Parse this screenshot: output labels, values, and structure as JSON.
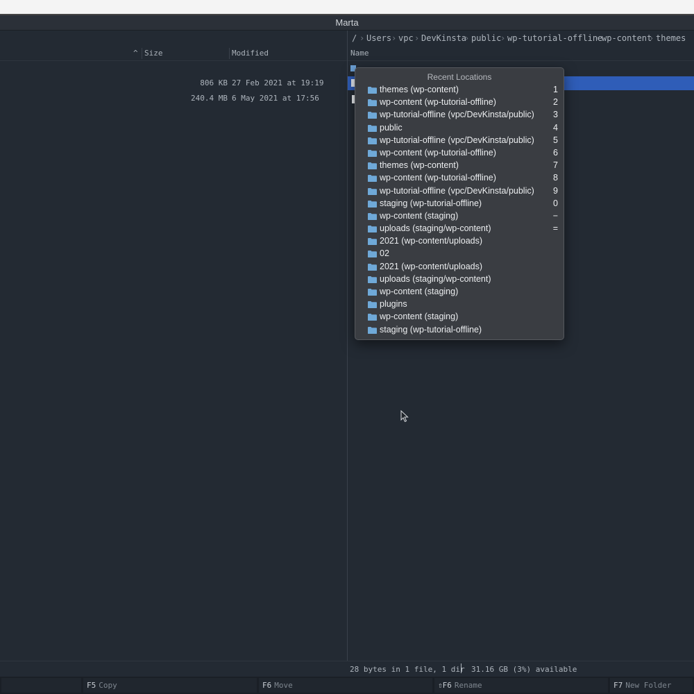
{
  "window": {
    "title": "Marta"
  },
  "left_pane": {
    "columns": {
      "size": "Size",
      "modified": "Modified",
      "sort_indicator": "^"
    },
    "rows": [
      {
        "size": "806 KB",
        "modified": "27 Feb 2021 at 19:19"
      },
      {
        "size": "240.4 MB",
        "modified": "6 May 2021 at 17:56"
      }
    ]
  },
  "right_pane": {
    "breadcrumb": [
      "/",
      "Users",
      "vpc",
      "DevKinsta",
      "public",
      "wp-tutorial-offline",
      "wp-content",
      "themes"
    ],
    "breadcrumb_separator": "›",
    "columns": {
      "name": "Name"
    },
    "status": {
      "summary": "28 bytes in 1 file, 1 dir",
      "available": "31.16 GB (3%) available"
    }
  },
  "recent_locations": {
    "title": "Recent Locations",
    "items": [
      {
        "label": "themes (wp-content)",
        "key": "1"
      },
      {
        "label": "wp-content (wp-tutorial-offline)",
        "key": "2"
      },
      {
        "label": "wp-tutorial-offline (vpc/DevKinsta/public)",
        "key": "3"
      },
      {
        "label": "public",
        "key": "4"
      },
      {
        "label": "wp-tutorial-offline (vpc/DevKinsta/public)",
        "key": "5"
      },
      {
        "label": "wp-content (wp-tutorial-offline)",
        "key": "6"
      },
      {
        "label": "themes (wp-content)",
        "key": "7"
      },
      {
        "label": "wp-content (wp-tutorial-offline)",
        "key": "8"
      },
      {
        "label": "wp-tutorial-offline (vpc/DevKinsta/public)",
        "key": "9"
      },
      {
        "label": "staging (wp-tutorial-offline)",
        "key": "0"
      },
      {
        "label": "wp-content (staging)",
        "key": "−"
      },
      {
        "label": "uploads (staging/wp-content)",
        "key": "="
      },
      {
        "label": "2021 (wp-content/uploads)",
        "key": ""
      },
      {
        "label": "02",
        "key": ""
      },
      {
        "label": "2021 (wp-content/uploads)",
        "key": ""
      },
      {
        "label": "uploads (staging/wp-content)",
        "key": ""
      },
      {
        "label": "wp-content (staging)",
        "key": ""
      },
      {
        "label": "plugins",
        "key": ""
      },
      {
        "label": "wp-content (staging)",
        "key": ""
      },
      {
        "label": "staging (wp-tutorial-offline)",
        "key": ""
      }
    ],
    "icon": "folder-icon",
    "folder_color": "#6fa8d8"
  },
  "function_keys": [
    {
      "key": "F5",
      "label": "Copy"
    },
    {
      "key": "F6",
      "label": "Move"
    },
    {
      "key": "⇧F6",
      "label": "Rename"
    },
    {
      "key": "F7",
      "label": "New Folder"
    }
  ],
  "colors": {
    "background": "#232a33",
    "selection": "#2f5db8",
    "popup_bg": "#3a3d42"
  }
}
